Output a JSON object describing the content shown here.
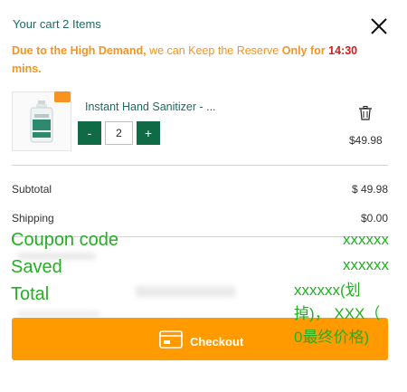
{
  "cart": {
    "title": "Your cart 2  Items"
  },
  "notice": {
    "part1": "Due to the High Demand,",
    "part2": " we can Keep the Reserve ",
    "part3": "Only for ",
    "time": "14:30",
    "part4": "mins."
  },
  "item": {
    "name": "Instant Hand Sanitizer - ...",
    "quantity": "2",
    "minus": "-",
    "plus": "+",
    "price": "$49.98"
  },
  "summary": {
    "subtotal_label": "Subtotal",
    "subtotal_value": "$ 49.98",
    "shipping_label": "Shipping",
    "shipping_value": "$0.00"
  },
  "annotations": {
    "coupon_label": "Coupon code",
    "saved_label": "Saved",
    "total_label": "Total",
    "coupon_value": "xxxxxx",
    "saved_value": "xxxxxx",
    "total_line1": "xxxxxx(划",
    "total_line2": "掉)， XXX（",
    "total_line3": "0最终价格)"
  },
  "checkout": {
    "label": "Checkout"
  },
  "icons": {
    "close": "close-icon",
    "trash": "trash-icon",
    "checkout": "credit-card-icon"
  },
  "colors": {
    "accent_orange": "#ff9a00",
    "brand_green": "#0f6a45",
    "title_teal": "#1e6b63",
    "urgent_red": "#e0181b",
    "annotation_green": "#22b022"
  }
}
